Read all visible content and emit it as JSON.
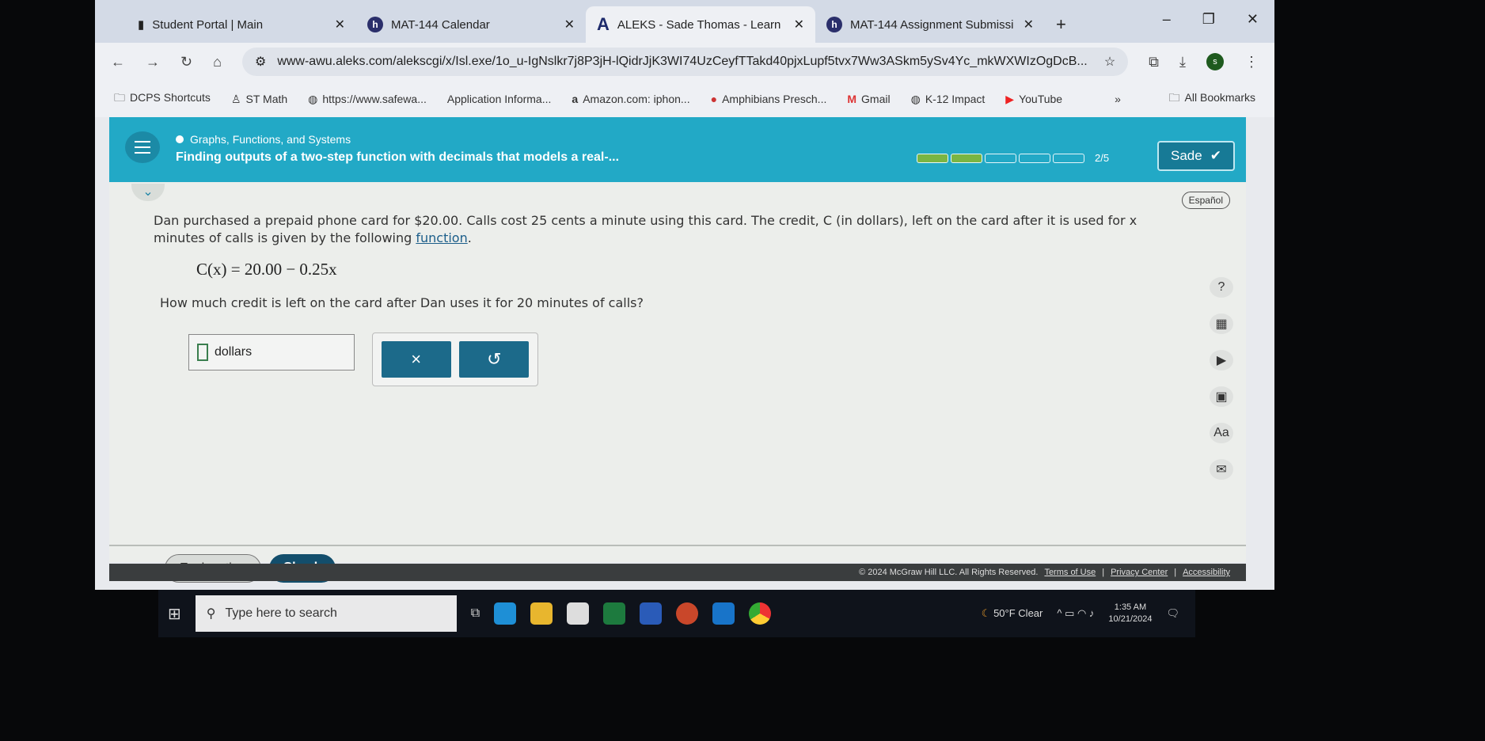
{
  "browser": {
    "tabs": [
      {
        "label": "Student Portal | Main",
        "icon": "portal-icon",
        "active": false
      },
      {
        "label": "MAT-144 Calendar",
        "icon": "h-logo-icon",
        "active": false
      },
      {
        "label": "ALEKS - Sade Thomas - Learn",
        "icon": "aleks-a-icon",
        "active": true
      },
      {
        "label": "MAT-144 Assignment Submissi",
        "icon": "h-logo-icon",
        "active": false
      }
    ],
    "new_tab": "+",
    "url": "www-awu.aleks.com/alekscgi/x/Isl.exe/1o_u-IgNslkr7j8P3jH-lQidrJjK3WI74UzCeyfTTakd40pjxLupf5tvx7Ww3ASkm5ySv4Yc_mkWXWIzOgDcB...",
    "profile_initial": "s",
    "bookmarks": [
      "DCPS Shortcuts",
      "ST Math",
      "https://www.safewa...",
      "Application Informa...",
      "Amazon.com: iphon...",
      "Amphibians Presch...",
      "Gmail",
      "K-12 Impact",
      "YouTube"
    ],
    "more": "»",
    "all_bookmarks": "All Bookmarks"
  },
  "aleks": {
    "topic": "Graphs, Functions, and Systems",
    "title": "Finding outputs of a two-step function with decimals that models a real-...",
    "progress": {
      "completed": 2,
      "total": 5,
      "label": "2/5"
    },
    "user": "Sade",
    "espanol": "Español",
    "question_text": "Dan purchased a prepaid phone card for $20.00. Calls cost 25 cents a minute using this card. The credit, C (in dollars), left on the card after it is used for x minutes of calls is given by the following ",
    "function_link": "function",
    "equation": "C(x) = 20.00 − 0.25x",
    "ask": "How much credit is left on the card after Dan uses it for 20 minutes of calls?",
    "answer_value": "",
    "answer_unit": "dollars",
    "clear_symbol": "×",
    "undo_symbol": "↺",
    "help": "?",
    "explanation": "Explanation",
    "check": "Check",
    "copyright": "© 2024 McGraw Hill LLC. All Rights Reserved.",
    "terms": "Terms of Use",
    "privacy": "Privacy Center",
    "accessibility": "Accessibility"
  },
  "taskbar": {
    "search_placeholder": "Type here to search",
    "weather": "50°F  Clear",
    "time": "1:35 AM",
    "date": "10/21/2024"
  }
}
